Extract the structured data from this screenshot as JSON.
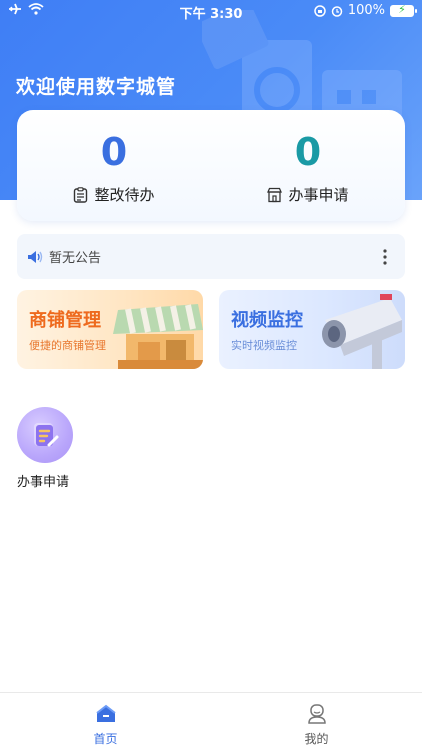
{
  "status_bar": {
    "time": "下午 3:30",
    "battery": "100%"
  },
  "header": {
    "title": "欢迎使用数字城管"
  },
  "stats": [
    {
      "value": "0",
      "label": "整改待办",
      "icon": "clipboard-icon"
    },
    {
      "value": "0",
      "label": "办事申请",
      "icon": "shop-icon"
    }
  ],
  "notice": {
    "text": "暂无公告",
    "icon": "speaker-icon"
  },
  "features": [
    {
      "title": "商铺管理",
      "subtitle": "便捷的商铺管理",
      "icon": "storefront-illustration"
    },
    {
      "title": "视频监控",
      "subtitle": "实时视频监控",
      "icon": "camera-illustration"
    }
  ],
  "apps": [
    {
      "label": "办事申请",
      "icon": "document-edit-icon"
    }
  ],
  "tabbar": {
    "items": [
      {
        "label": "首页",
        "icon": "home-icon",
        "active": true
      },
      {
        "label": "我的",
        "icon": "user-icon",
        "active": false
      }
    ]
  },
  "colors": {
    "primary": "#3a6fe0",
    "header_blue": "#4a8bf7",
    "teal": "#1a9aa5",
    "orange": "#ee6a1e"
  }
}
